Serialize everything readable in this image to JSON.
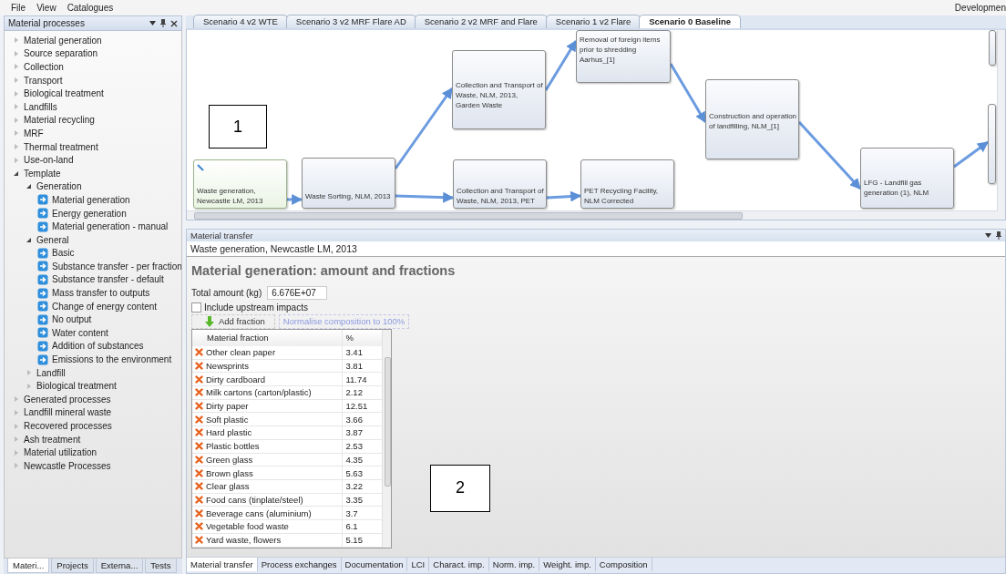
{
  "menu": [
    {
      "label": "File"
    },
    {
      "label": "View"
    },
    {
      "label": "Catalogues"
    }
  ],
  "menu_right": "Developmen",
  "sidebar": {
    "title": "Material processes",
    "items": [
      {
        "label": "Material generation",
        "kind": "group",
        "expanded": false
      },
      {
        "label": "Source separation",
        "kind": "group",
        "expanded": false
      },
      {
        "label": "Collection",
        "kind": "group",
        "expanded": false
      },
      {
        "label": "Transport",
        "kind": "group",
        "expanded": false
      },
      {
        "label": "Biological treatment",
        "kind": "group",
        "expanded": false
      },
      {
        "label": "Landfills",
        "kind": "group",
        "expanded": false
      },
      {
        "label": "Material recycling",
        "kind": "group",
        "expanded": false
      },
      {
        "label": "MRF",
        "kind": "group",
        "expanded": false
      },
      {
        "label": "Thermal treatment",
        "kind": "group",
        "expanded": false
      },
      {
        "label": "Use-on-land",
        "kind": "group",
        "expanded": false
      },
      {
        "label": "Template",
        "kind": "group",
        "expanded": true,
        "children": [
          {
            "label": "Generation",
            "kind": "group",
            "expanded": true,
            "children": [
              {
                "label": "Material generation",
                "kind": "template"
              },
              {
                "label": "Energy generation",
                "kind": "template"
              },
              {
                "label": "Material generation - manual",
                "kind": "template"
              }
            ]
          },
          {
            "label": "General",
            "kind": "group",
            "expanded": true,
            "children": [
              {
                "label": "Basic",
                "kind": "template"
              },
              {
                "label": "Substance transfer - per fraction",
                "kind": "template"
              },
              {
                "label": "Substance transfer - default",
                "kind": "template"
              },
              {
                "label": "Mass transfer to outputs",
                "kind": "template"
              },
              {
                "label": "Change of energy content",
                "kind": "template"
              },
              {
                "label": "No output",
                "kind": "template"
              },
              {
                "label": "Water content",
                "kind": "template"
              },
              {
                "label": "Addition of substances",
                "kind": "template"
              },
              {
                "label": "Emissions to the environment",
                "kind": "template"
              }
            ]
          },
          {
            "label": "Landfill",
            "kind": "group",
            "expanded": false
          },
          {
            "label": "Biological treatment",
            "kind": "group",
            "expanded": false
          }
        ]
      },
      {
        "label": "Generated processes",
        "kind": "group",
        "expanded": false
      },
      {
        "label": "Landfill mineral waste",
        "kind": "group",
        "expanded": false
      },
      {
        "label": "Recovered processes",
        "kind": "group",
        "expanded": false
      },
      {
        "label": "Ash treatment",
        "kind": "group",
        "expanded": false
      },
      {
        "label": "Material utilization",
        "kind": "group",
        "expanded": false
      },
      {
        "label": "Newcastle Processes",
        "kind": "group",
        "expanded": false
      }
    ]
  },
  "sidebar_tabs": [
    {
      "label": "Materi...",
      "selected": true
    },
    {
      "label": "Projects",
      "selected": false
    },
    {
      "label": "Externa...",
      "selected": false
    },
    {
      "label": "Tests",
      "selected": false
    }
  ],
  "scenario_tabs": [
    {
      "label": "Scenario 4 v2 WTE",
      "selected": false
    },
    {
      "label": "Scenario 3 v2 MRF Flare AD",
      "selected": false
    },
    {
      "label": "Scenario 2 v2 MRF and Flare",
      "selected": false
    },
    {
      "label": "Scenario 1 v2 Flare",
      "selected": false
    },
    {
      "label": "Scenario 0 Baseline",
      "selected": true
    }
  ],
  "diagram": {
    "callout": "1",
    "nodes": [
      {
        "label": "Waste generation, Newcastle LM, 2013",
        "kind": "source"
      },
      {
        "label": "Waste Sorting, NLM, 2013",
        "kind": "process"
      },
      {
        "label": "Collection and Transport of Waste, NLM, 2013, Garden Waste",
        "kind": "process"
      },
      {
        "label": "Removal of foreign items prior to shredding Aarhus_[1]",
        "kind": "process"
      },
      {
        "label": "Collection and Transport of Waste, NLM, 2013, PET",
        "kind": "process"
      },
      {
        "label": "PET Recycling Facility, NLM Corrected",
        "kind": "process"
      },
      {
        "label": "Construction and operation of landfilling, NLM_[1]",
        "kind": "process"
      },
      {
        "label": "LFG - Landfill gas generation (1), NLM",
        "kind": "process"
      },
      {
        "kind": "process"
      },
      {
        "kind": "process"
      }
    ]
  },
  "editor": {
    "panel_title": "Material transfer",
    "process_name": "Waste generation, Newcastle LM, 2013",
    "heading": "Material generation: amount and fractions",
    "total_label": "Total amount (kg)",
    "total_value": "6.676E+07",
    "include_upstream": {
      "label": "Include upstream impacts",
      "checked": false
    },
    "add_button": "Add fraction",
    "normalise_button": "Normalise composition to 100%",
    "callout": "2",
    "table": {
      "columns": [
        "Material fraction",
        "%"
      ],
      "rows": [
        {
          "name": "Other clean paper",
          "value": "3.41"
        },
        {
          "name": "Newsprints",
          "value": "3.81"
        },
        {
          "name": "Dirty cardboard",
          "value": "11.74"
        },
        {
          "name": "Milk cartons (carton/plastic)",
          "value": "2.12"
        },
        {
          "name": "Dirty paper",
          "value": "12.51"
        },
        {
          "name": "Soft plastic",
          "value": "3.66"
        },
        {
          "name": "Hard plastic",
          "value": "3.87"
        },
        {
          "name": "Plastic bottles",
          "value": "2.53"
        },
        {
          "name": "Green glass",
          "value": "4.35"
        },
        {
          "name": "Brown glass",
          "value": "5.63"
        },
        {
          "name": "Clear glass",
          "value": "3.22"
        },
        {
          "name": "Food cans (tinplate/steel)",
          "value": "3.35"
        },
        {
          "name": "Beverage cans (aluminium)",
          "value": "3.7"
        },
        {
          "name": "Vegetable food waste",
          "value": "6.1"
        },
        {
          "name": "Yard waste, flowers",
          "value": "5.15"
        }
      ]
    }
  },
  "editor_tabs": [
    {
      "label": "Material transfer",
      "selected": true
    },
    {
      "label": "Process exchanges",
      "selected": false
    },
    {
      "label": "Documentation",
      "selected": false
    },
    {
      "label": "LCI",
      "selected": false
    },
    {
      "label": "Charact. imp.",
      "selected": false
    },
    {
      "label": "Norm. imp.",
      "selected": false
    },
    {
      "label": "Weight. imp.",
      "selected": false
    },
    {
      "label": "Composition",
      "selected": false
    }
  ]
}
